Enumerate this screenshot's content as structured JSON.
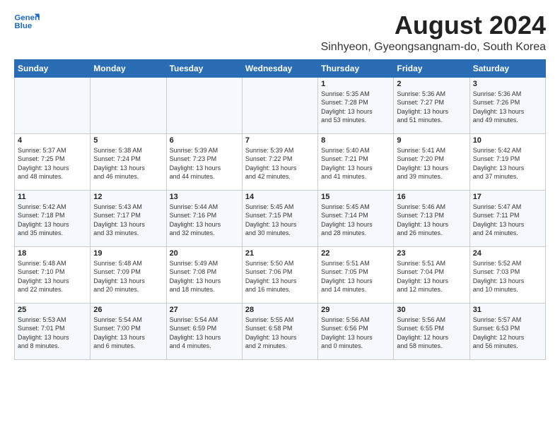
{
  "logo": {
    "line1": "General",
    "line2": "Blue"
  },
  "title": "August 2024",
  "subtitle": "Sinhyeon, Gyeongsangnam-do, South Korea",
  "days_of_week": [
    "Sunday",
    "Monday",
    "Tuesday",
    "Wednesday",
    "Thursday",
    "Friday",
    "Saturday"
  ],
  "weeks": [
    [
      {
        "day": "",
        "info": ""
      },
      {
        "day": "",
        "info": ""
      },
      {
        "day": "",
        "info": ""
      },
      {
        "day": "",
        "info": ""
      },
      {
        "day": "1",
        "info": "Sunrise: 5:35 AM\nSunset: 7:28 PM\nDaylight: 13 hours\nand 53 minutes."
      },
      {
        "day": "2",
        "info": "Sunrise: 5:36 AM\nSunset: 7:27 PM\nDaylight: 13 hours\nand 51 minutes."
      },
      {
        "day": "3",
        "info": "Sunrise: 5:36 AM\nSunset: 7:26 PM\nDaylight: 13 hours\nand 49 minutes."
      }
    ],
    [
      {
        "day": "4",
        "info": "Sunrise: 5:37 AM\nSunset: 7:25 PM\nDaylight: 13 hours\nand 48 minutes."
      },
      {
        "day": "5",
        "info": "Sunrise: 5:38 AM\nSunset: 7:24 PM\nDaylight: 13 hours\nand 46 minutes."
      },
      {
        "day": "6",
        "info": "Sunrise: 5:39 AM\nSunset: 7:23 PM\nDaylight: 13 hours\nand 44 minutes."
      },
      {
        "day": "7",
        "info": "Sunrise: 5:39 AM\nSunset: 7:22 PM\nDaylight: 13 hours\nand 42 minutes."
      },
      {
        "day": "8",
        "info": "Sunrise: 5:40 AM\nSunset: 7:21 PM\nDaylight: 13 hours\nand 41 minutes."
      },
      {
        "day": "9",
        "info": "Sunrise: 5:41 AM\nSunset: 7:20 PM\nDaylight: 13 hours\nand 39 minutes."
      },
      {
        "day": "10",
        "info": "Sunrise: 5:42 AM\nSunset: 7:19 PM\nDaylight: 13 hours\nand 37 minutes."
      }
    ],
    [
      {
        "day": "11",
        "info": "Sunrise: 5:42 AM\nSunset: 7:18 PM\nDaylight: 13 hours\nand 35 minutes."
      },
      {
        "day": "12",
        "info": "Sunrise: 5:43 AM\nSunset: 7:17 PM\nDaylight: 13 hours\nand 33 minutes."
      },
      {
        "day": "13",
        "info": "Sunrise: 5:44 AM\nSunset: 7:16 PM\nDaylight: 13 hours\nand 32 minutes."
      },
      {
        "day": "14",
        "info": "Sunrise: 5:45 AM\nSunset: 7:15 PM\nDaylight: 13 hours\nand 30 minutes."
      },
      {
        "day": "15",
        "info": "Sunrise: 5:45 AM\nSunset: 7:14 PM\nDaylight: 13 hours\nand 28 minutes."
      },
      {
        "day": "16",
        "info": "Sunrise: 5:46 AM\nSunset: 7:13 PM\nDaylight: 13 hours\nand 26 minutes."
      },
      {
        "day": "17",
        "info": "Sunrise: 5:47 AM\nSunset: 7:11 PM\nDaylight: 13 hours\nand 24 minutes."
      }
    ],
    [
      {
        "day": "18",
        "info": "Sunrise: 5:48 AM\nSunset: 7:10 PM\nDaylight: 13 hours\nand 22 minutes."
      },
      {
        "day": "19",
        "info": "Sunrise: 5:48 AM\nSunset: 7:09 PM\nDaylight: 13 hours\nand 20 minutes."
      },
      {
        "day": "20",
        "info": "Sunrise: 5:49 AM\nSunset: 7:08 PM\nDaylight: 13 hours\nand 18 minutes."
      },
      {
        "day": "21",
        "info": "Sunrise: 5:50 AM\nSunset: 7:06 PM\nDaylight: 13 hours\nand 16 minutes."
      },
      {
        "day": "22",
        "info": "Sunrise: 5:51 AM\nSunset: 7:05 PM\nDaylight: 13 hours\nand 14 minutes."
      },
      {
        "day": "23",
        "info": "Sunrise: 5:51 AM\nSunset: 7:04 PM\nDaylight: 13 hours\nand 12 minutes."
      },
      {
        "day": "24",
        "info": "Sunrise: 5:52 AM\nSunset: 7:03 PM\nDaylight: 13 hours\nand 10 minutes."
      }
    ],
    [
      {
        "day": "25",
        "info": "Sunrise: 5:53 AM\nSunset: 7:01 PM\nDaylight: 13 hours\nand 8 minutes."
      },
      {
        "day": "26",
        "info": "Sunrise: 5:54 AM\nSunset: 7:00 PM\nDaylight: 13 hours\nand 6 minutes."
      },
      {
        "day": "27",
        "info": "Sunrise: 5:54 AM\nSunset: 6:59 PM\nDaylight: 13 hours\nand 4 minutes."
      },
      {
        "day": "28",
        "info": "Sunrise: 5:55 AM\nSunset: 6:58 PM\nDaylight: 13 hours\nand 2 minutes."
      },
      {
        "day": "29",
        "info": "Sunrise: 5:56 AM\nSunset: 6:56 PM\nDaylight: 13 hours\nand 0 minutes."
      },
      {
        "day": "30",
        "info": "Sunrise: 5:56 AM\nSunset: 6:55 PM\nDaylight: 12 hours\nand 58 minutes."
      },
      {
        "day": "31",
        "info": "Sunrise: 5:57 AM\nSunset: 6:53 PM\nDaylight: 12 hours\nand 56 minutes."
      }
    ]
  ]
}
